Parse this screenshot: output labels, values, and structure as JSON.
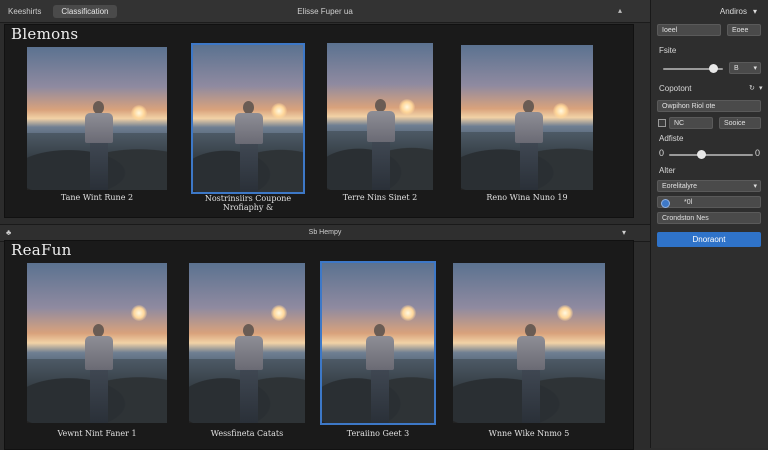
{
  "topbar": {
    "tabs": [
      "Keeshirts",
      "Classification"
    ],
    "center_title": "Elisse Fuper ua"
  },
  "panels": [
    {
      "title": "Blemons",
      "captions": [
        "Tane Wint Rune 2",
        "Nostrinsiirs Coupone Nrofiaphy &",
        "Terre Nins Sinet 2",
        "Reno Wina Nuno 19"
      ]
    },
    {
      "title": "ReaFun",
      "captions": [
        "Vewnt Nint Faner 1",
        "Wessfineta Catats",
        "Teraiino Geet 3",
        "Wnne Wike Nnmo 5"
      ]
    }
  ],
  "section_bar": {
    "label": "Sb Hempy"
  },
  "sidebar": {
    "header": "Andiros",
    "top_buttons": [
      "Ioeel",
      "Eoee"
    ],
    "label_rows": "Fsite",
    "slider1_value_label": "B",
    "label_ope": "Copotont",
    "select1": "Owpihon Riol ote",
    "field_small": "NC",
    "field_small2": "Sooice",
    "label_adjust": "Adfiste",
    "slider2_min": "0",
    "slider2_max": "0",
    "slider2_level": 0.38,
    "label_alter": "Alter",
    "select2": "Eorelitalyre",
    "field_with_radio": "*0l",
    "field3": "Crondston Nes",
    "primary_button": "Dnoraont"
  },
  "colors": {
    "accent": "#2f73c9",
    "selection": "#3d78c7"
  }
}
